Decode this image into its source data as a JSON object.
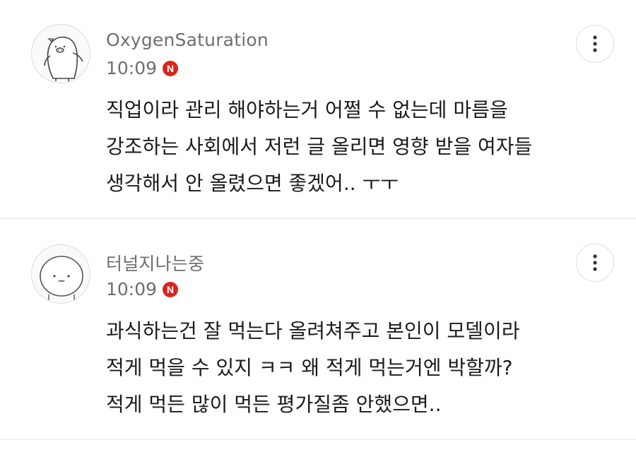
{
  "comments": [
    {
      "nickname": "OxygenSaturation",
      "time": "10:09",
      "badge": "N",
      "lines": [
        "직업이라 관리 해야하는거 어쩔 수 없는데 마름을",
        "강조하는 사회에서 저런 글 올리면 영향 받을 여자들",
        "생각해서 안 올렸으면 좋겠어.. ㅜㅜ"
      ],
      "avatar_icon": "penguin-avatar-icon"
    },
    {
      "nickname": "터널지나는중",
      "time": "10:09",
      "badge": "N",
      "lines": [
        "과식하는건 잘 먹는다 올려쳐주고 본인이 모델이라",
        "적게 먹을 수 있지 ㅋㅋ 왜 적게 먹는거엔 박할까?",
        "적게 먹든 많이 먹든 평가질좀 안했으면.."
      ],
      "avatar_icon": "round-face-avatar-icon"
    }
  ],
  "colors": {
    "badge": "#d9251c",
    "meta_text": "#6f6f6f",
    "divider": "#e6e6e6"
  },
  "icons": {
    "more": "more-vertical-icon"
  }
}
